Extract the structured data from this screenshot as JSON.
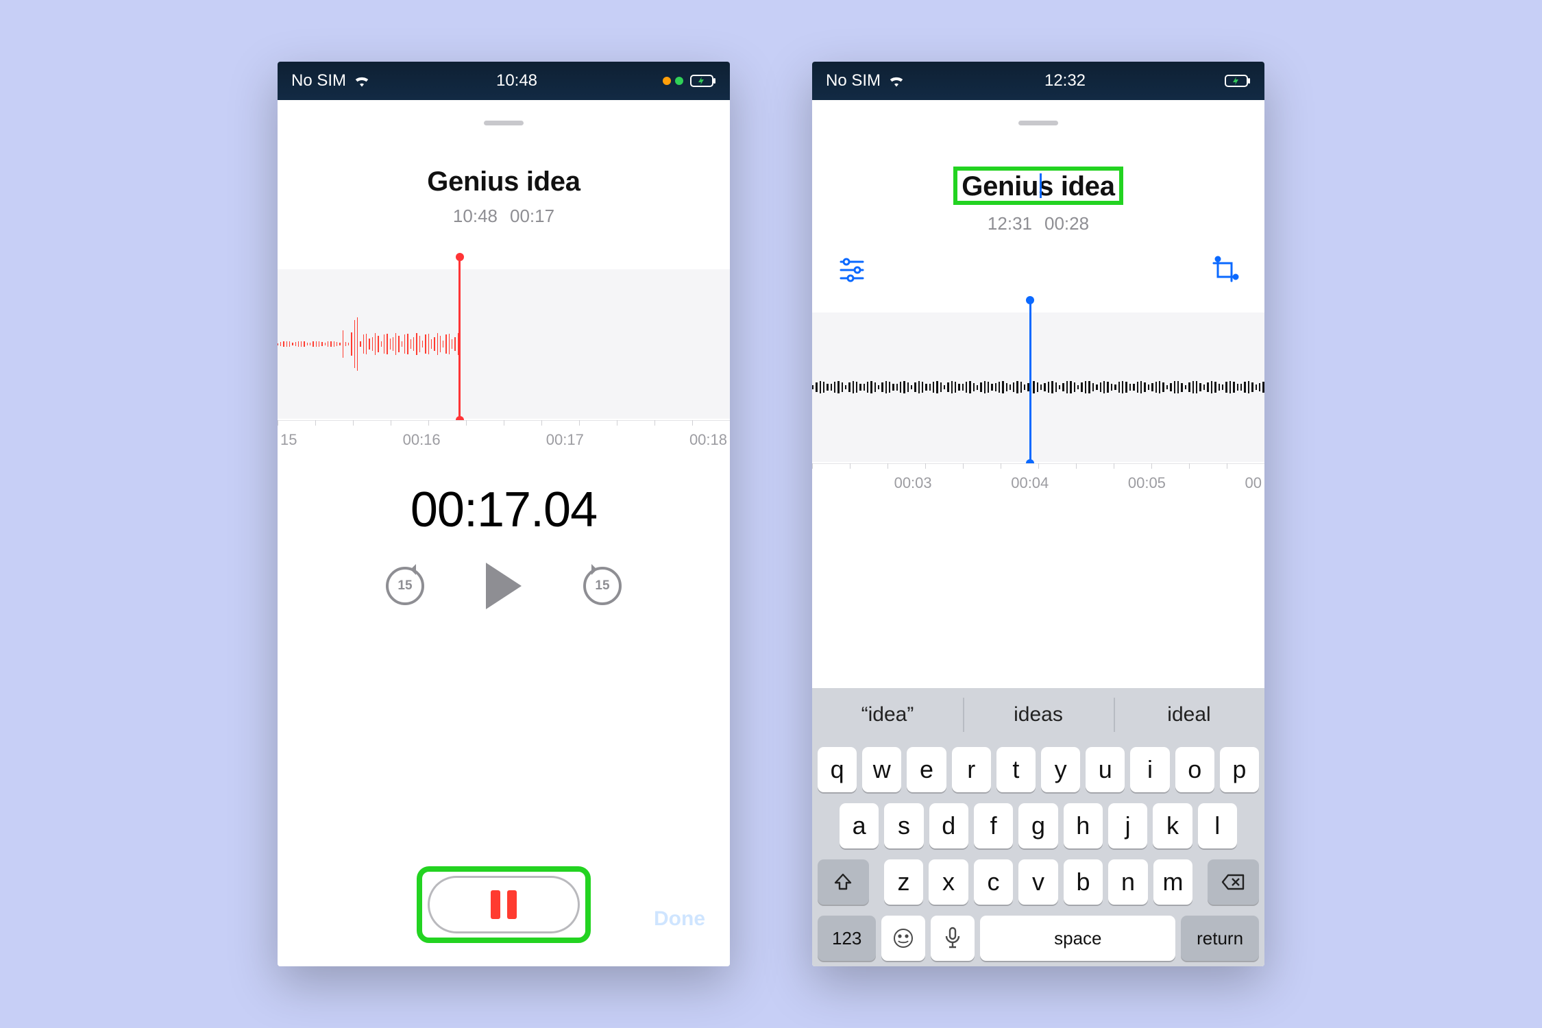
{
  "highlight_color": "#23d321",
  "phone1": {
    "status": {
      "carrier": "No SIM",
      "clock": "10:48"
    },
    "title": "Genius idea",
    "meta_time": "10:48",
    "meta_dur": "00:17",
    "timeline_labels": [
      "15",
      "00:16",
      "00:17",
      "00:18"
    ],
    "timer": "00:17.04",
    "skip_seconds": "15",
    "done_label": "Done"
  },
  "phone2": {
    "status": {
      "carrier": "No SIM",
      "clock": "12:32"
    },
    "title": "Genius idea",
    "meta_time": "12:31",
    "meta_dur": "00:28",
    "timeline_labels": [
      "00:03",
      "00:04",
      "00:05",
      "00"
    ],
    "keyboard": {
      "suggestions": [
        "“idea”",
        "ideas",
        "ideal"
      ],
      "row1": [
        "q",
        "w",
        "e",
        "r",
        "t",
        "y",
        "u",
        "i",
        "o",
        "p"
      ],
      "row2": [
        "a",
        "s",
        "d",
        "f",
        "g",
        "h",
        "j",
        "k",
        "l"
      ],
      "row3": [
        "z",
        "x",
        "c",
        "v",
        "b",
        "n",
        "m"
      ],
      "numbers_label": "123",
      "space_label": "space",
      "return_label": "return"
    }
  }
}
